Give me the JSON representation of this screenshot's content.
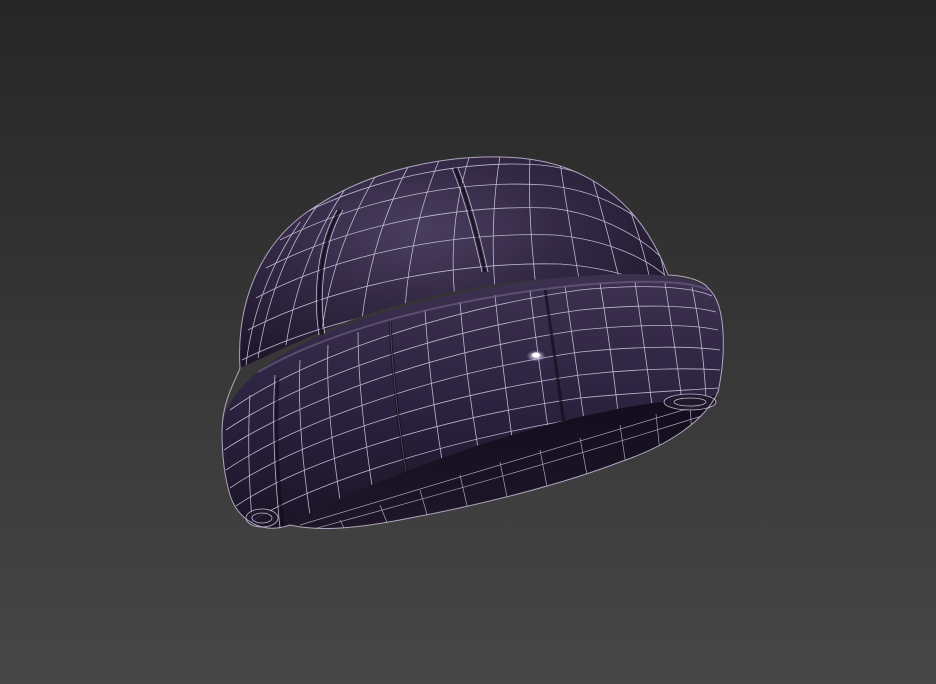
{
  "viewport": {
    "background_top": "#262626",
    "background_bottom": "#474747"
  },
  "model": {
    "subject": "beanie-hat-mesh",
    "shading": "smooth-shaded-with-wireframe-overlay",
    "base_color": "#2e2540",
    "shadow_color": "#150f1f",
    "highlight_color": "#5a4d70",
    "wire_color": "#d8d0ea"
  }
}
